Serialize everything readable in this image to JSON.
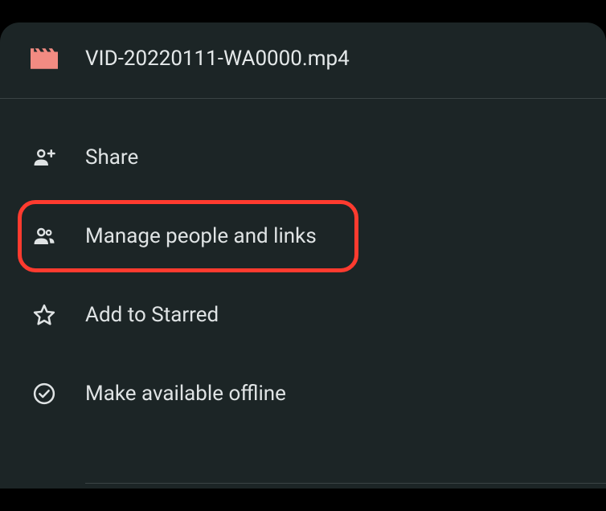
{
  "header": {
    "filename": "VID-20220111-WA0000.mp4"
  },
  "menu": {
    "items": {
      "share": {
        "label": "Share"
      },
      "manage": {
        "label": "Manage people and links"
      },
      "star": {
        "label": "Add to Starred"
      },
      "offline": {
        "label": "Make available offline"
      }
    }
  }
}
